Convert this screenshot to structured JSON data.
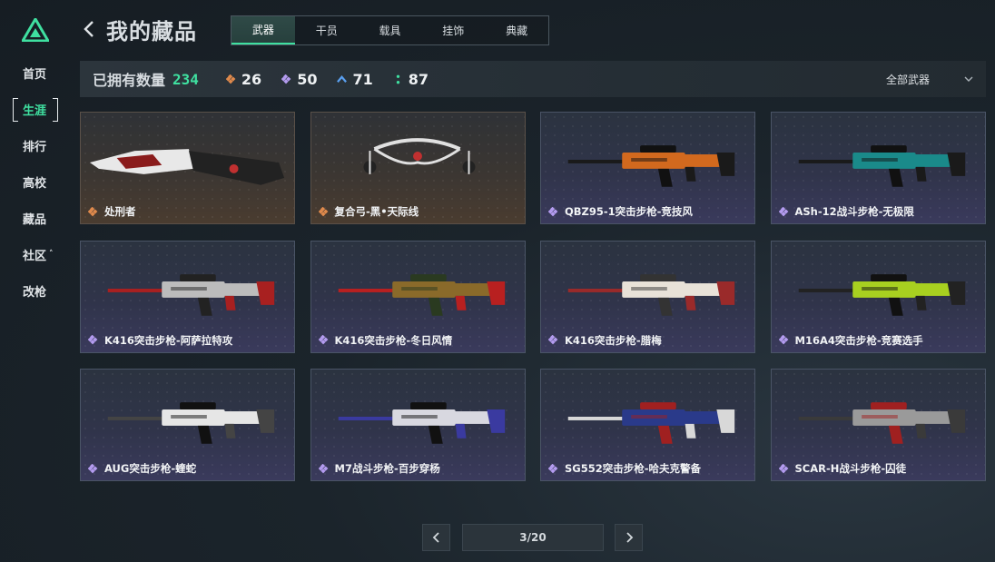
{
  "page": {
    "title": "我的藏品"
  },
  "nav": {
    "items": [
      {
        "label": "首页",
        "active": false
      },
      {
        "label": "生涯",
        "active": true
      },
      {
        "label": "排行",
        "active": false
      },
      {
        "label": "高校",
        "active": false
      },
      {
        "label": "藏品",
        "active": false
      },
      {
        "label": "社区",
        "active": false,
        "caret": "˄"
      },
      {
        "label": "改枪",
        "active": false
      }
    ]
  },
  "tabs": [
    {
      "label": "武器",
      "active": true
    },
    {
      "label": "干员",
      "active": false
    },
    {
      "label": "载具",
      "active": false
    },
    {
      "label": "挂饰",
      "active": false
    },
    {
      "label": "典藏",
      "active": false
    }
  ],
  "stats": {
    "own_label": "已拥有数量",
    "own_count": "234",
    "rarities": [
      {
        "icon": "orange-diamond-icon",
        "color": "#e08a4c",
        "value": "26"
      },
      {
        "icon": "purple-diamond-icon",
        "color": "#b49cf0",
        "value": "50"
      },
      {
        "icon": "blue-chevron-icon",
        "color": "#5aa0f0",
        "value": "71"
      },
      {
        "icon": "green-dots-icon",
        "color": "#3fe0a0",
        "value": "87"
      }
    ],
    "filter_label": "全部武器"
  },
  "items": [
    {
      "name": "处刑者",
      "rarity": "orange",
      "weapon": "knife"
    },
    {
      "name": "复合弓-黑•天际线",
      "rarity": "orange",
      "weapon": "bow"
    },
    {
      "name": "QBZ95-1突击步枪-竞技风",
      "rarity": "purple",
      "weapon": "bullpup-orange"
    },
    {
      "name": "ASh-12战斗步枪-无极限",
      "rarity": "purple",
      "weapon": "bullpup-teal"
    },
    {
      "name": "K416突击步枪-阿萨拉特攻",
      "rarity": "purple",
      "weapon": "rifle-red"
    },
    {
      "name": "K416突击步枪-冬日风情",
      "rarity": "purple",
      "weapon": "rifle-festive"
    },
    {
      "name": "K416突击步枪-腊梅",
      "rarity": "purple",
      "weapon": "rifle-white"
    },
    {
      "name": "M16A4突击步枪-竞赛选手",
      "rarity": "purple",
      "weapon": "rifle-lime"
    },
    {
      "name": "AUG突击步枪-蝰蛇",
      "rarity": "purple",
      "weapon": "aug-white"
    },
    {
      "name": "M7战斗步枪-百步穿杨",
      "rarity": "purple",
      "weapon": "m7-white"
    },
    {
      "name": "SG552突击步枪-哈夫克警备",
      "rarity": "purple",
      "weapon": "sg552-blue"
    },
    {
      "name": "SCAR-H战斗步枪-囚徒",
      "rarity": "purple",
      "weapon": "scar-grey"
    }
  ],
  "colors": {
    "accent": "#3fe0a0",
    "orange": "#e08a4c",
    "purple": "#b49cf0"
  },
  "pagination": {
    "text": "3/20"
  }
}
